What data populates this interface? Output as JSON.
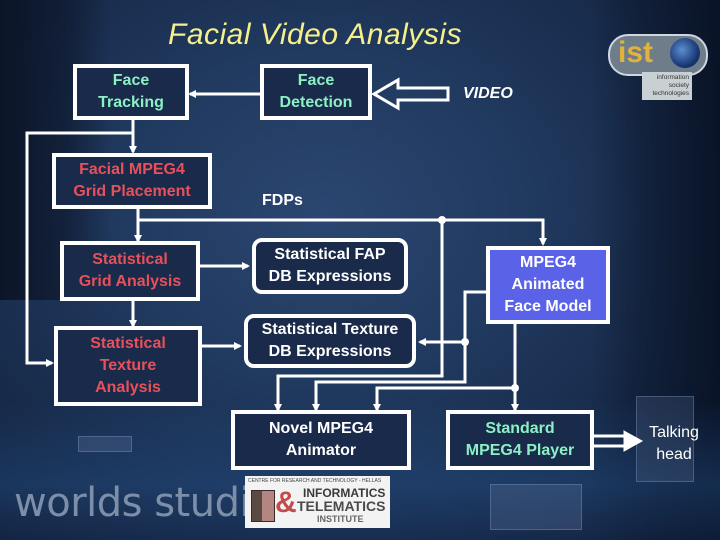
{
  "title": "Facial Video Analysis",
  "colors": {
    "title": "#f6f08a",
    "green_text": "#8df0c4",
    "red_text": "#e8505a",
    "blue_box": "#5a63e8",
    "line": "#ffffff"
  },
  "nodes": {
    "face_tracking": "Face\nTracking",
    "face_detection": "Face\nDetection",
    "grid_placement": "Facial MPEG4\nGrid Placement",
    "grid_analysis": "Statistical\nGrid Analysis",
    "texture_analysis": "Statistical\nTexture\nAnalysis",
    "fap_db": "Statistical FAP\nDB Expressions",
    "texture_db": "Statistical Texture\nDB Expressions",
    "face_model": "MPEG4\nAnimated\nFace Model",
    "animator": "Novel MPEG4\nAnimator",
    "player": "Standard\nMPEG4 Player"
  },
  "labels": {
    "video": "VIDEO",
    "fdps": "FDPs",
    "talking_head": "Talking\nhead"
  },
  "logos": {
    "ist": {
      "mark": "ist",
      "caption": "information\nsociety\ntechnologies"
    },
    "iti": {
      "top": "CENTRE FOR RESEARCH AND TECHNOLOGY - HELLAS",
      "amp": "&",
      "line1": "INFORMATICS",
      "line2": "TELEMATICS",
      "line3": "INSTITUTE"
    },
    "watermark": "worlds studio"
  }
}
